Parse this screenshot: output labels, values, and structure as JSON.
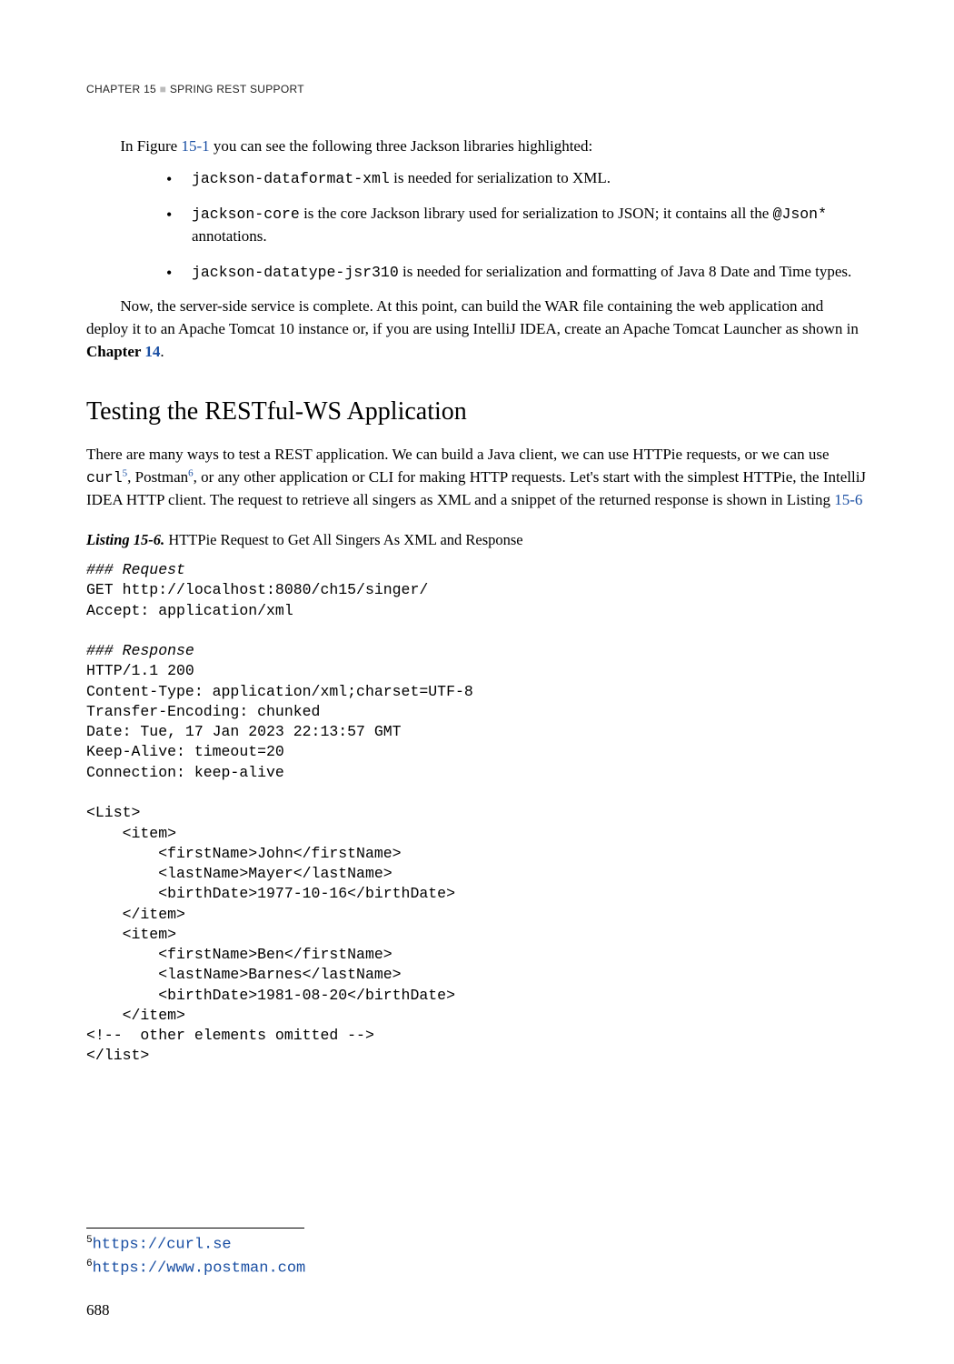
{
  "header": {
    "chapter": "Chapter 15",
    "title": "Spring Rest Support"
  },
  "intro": {
    "text_a": "In Figure ",
    "figref": "15-1",
    "text_b": " you can see the following three Jackson libraries highlighted:"
  },
  "bullets": [
    {
      "code": "jackson-dataformat-xml",
      "rest": " is needed for serialization to XML."
    },
    {
      "code": "jackson-core",
      "rest_a": " is the core Jackson library used for serialization to JSON; it contains all the ",
      "code2": "@Json*",
      "rest_b": " annotations."
    },
    {
      "code": "jackson-datatype-jsr310",
      "rest": " is needed for serialization and formatting of Java 8 Date and Time types."
    }
  ],
  "para2": {
    "text_a": "Now, the server-side service is complete. At this point, can build the WAR file containing the web application and deploy it to an Apache Tomcat 10 instance or, if you are using IntelliJ IDEA, create an Apache Tomcat Launcher as shown in ",
    "chapter_word": "Chapter ",
    "chapter_num": "14",
    "period": "."
  },
  "section_heading": "Testing the RESTful-WS Application",
  "para3": {
    "a": "There are many ways to test a REST application. We can build a Java client, we can use HTTPie requests, or we can use ",
    "curl": "curl",
    "fn5": "5",
    "b": ", Postman",
    "fn6": "6",
    "c": ", or any other application or CLI for making HTTP requests. Let's start with the simplest HTTPie, the IntelliJ IDEA HTTP client. The request to retrieve all singers as XML and a snippet of the returned response is shown in Listing ",
    "listing_ref": "15-6"
  },
  "listing": {
    "label": "Listing 15-6.",
    "caption": "  HTTPie Request to Get All Singers As XML and Response"
  },
  "code": {
    "req_comment": "### Request",
    "req_line1": "GET http://localhost:8080/ch15/singer/",
    "req_line2": "Accept: application/xml",
    "resp_comment": "### Response",
    "resp_lines": "HTTP/1.1 200\nContent-Type: application/xml;charset=UTF-8\nTransfer-Encoding: chunked\nDate: Tue, 17 Jan 2023 22:13:57 GMT\nKeep-Alive: timeout=20\nConnection: keep-alive",
    "xml": "<List>\n    <item>\n        <firstName>John</firstName>\n        <lastName>Mayer</lastName>\n        <birthDate>1977-10-16</birthDate>\n    </item>\n    <item>\n        <firstName>Ben</firstName>\n        <lastName>Barnes</lastName>\n        <birthDate>1981-08-20</birthDate>\n    </item>\n<!--  other elements omitted -->\n</list>"
  },
  "footnotes": {
    "fn5_mark": "5",
    "fn5_url": "https://curl.se",
    "fn6_mark": "6",
    "fn6_url": "https://www.postman.com"
  },
  "page_number": "688"
}
